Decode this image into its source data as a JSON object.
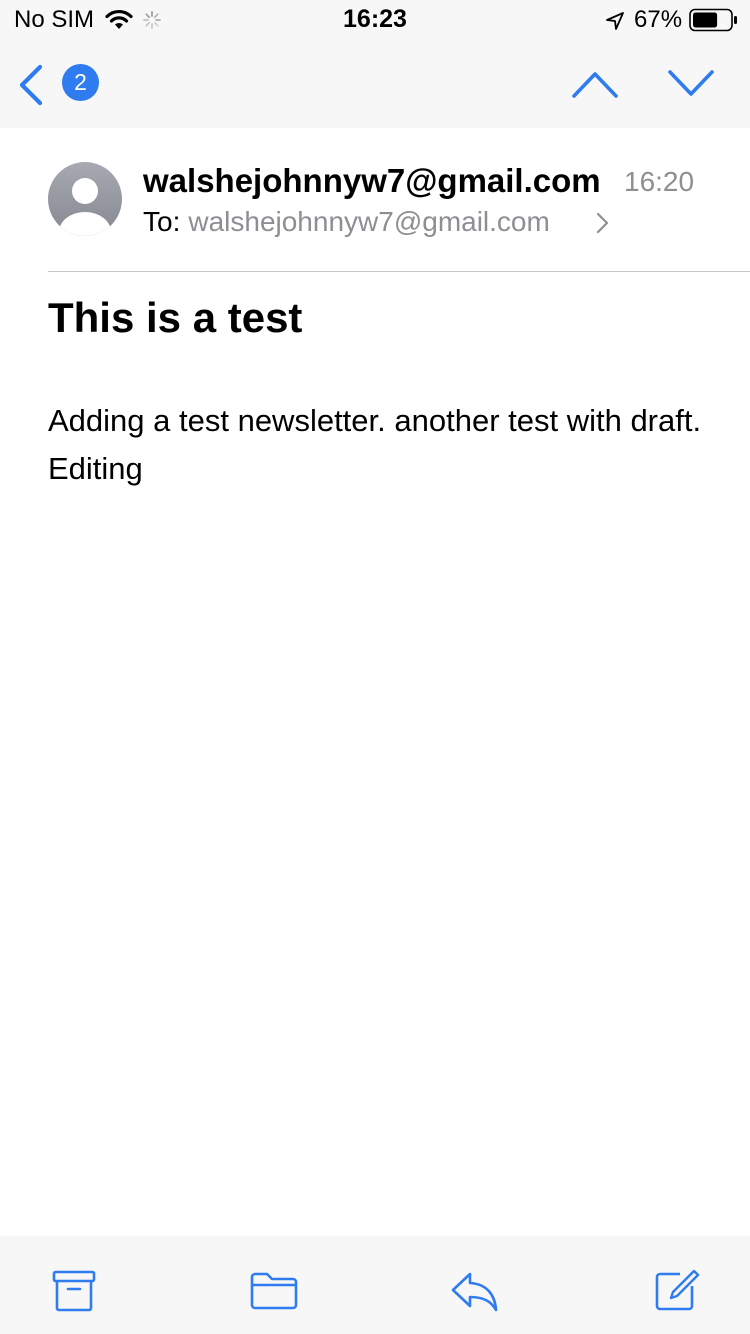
{
  "status_bar": {
    "carrier": "No SIM",
    "time": "16:23",
    "battery_percent": "67%",
    "battery_level": 0.67,
    "icons": [
      "wifi-icon",
      "loading-spinner-icon",
      "location-arrow-icon",
      "battery-icon"
    ]
  },
  "nav": {
    "unread_badge": "2",
    "icons": [
      "chevron-left-icon",
      "chevron-up-icon",
      "chevron-down-icon"
    ]
  },
  "message": {
    "sender": "walshejohnnyw7@gmail.com",
    "time": "16:20",
    "to_label": "To:",
    "to_address": "walshejohnnyw7@gmail.com",
    "subject": "This is a test",
    "body": "Adding a test newsletter. another test with draft. Editing"
  },
  "toolbar": {
    "icons": [
      "archive-icon",
      "folder-icon",
      "reply-icon",
      "compose-icon"
    ]
  },
  "colors": {
    "accent": "#2f7bf0",
    "secondary_text": "#8e8e93",
    "bar_background": "#f7f7f7"
  }
}
